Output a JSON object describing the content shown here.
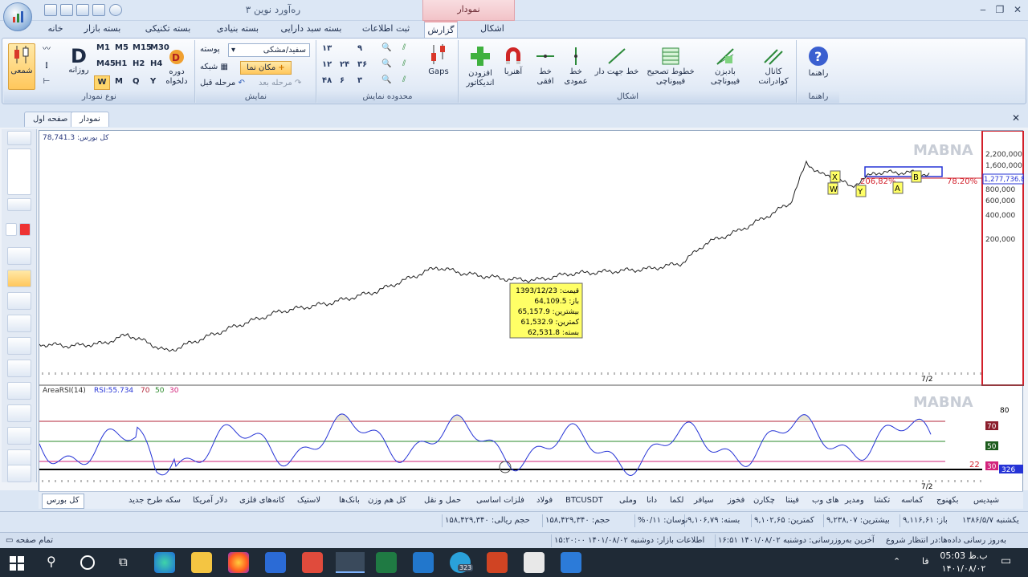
{
  "window": {
    "title": "ره‌آورد نوین ۳",
    "context_tab": "نمودار",
    "min": "‒",
    "restore": "❐",
    "close": "✕"
  },
  "tabs": [
    "خانه",
    "بسته بازار",
    "بسته تکنیکی",
    "بسته بنیادی",
    "بسته سبد دارایی",
    "ثبت اطلاعات",
    "گزارش",
    "اشکال"
  ],
  "ribbon": {
    "chart_type": {
      "label": "نوع نمودار",
      "candle": "شمعی",
      "daily": "روزانه",
      "period": "دوره دلخواه",
      "frames": [
        "M1",
        "M5",
        "M15",
        "M30",
        "M45",
        "H1",
        "H2",
        "H4"
      ],
      "wmqy": [
        "W",
        "M",
        "Q",
        "Y"
      ],
      "d": "D"
    },
    "display": {
      "label": "نمایش",
      "theme": "سفید/مشکی",
      "skin": "پوسته",
      "pointer": "مکان نما",
      "grid": "شبکه",
      "prev": "مرحله قبل",
      "next": "مرحله بعد"
    },
    "range": {
      "label": "محدوده نمایش",
      "nums": [
        "۱۳",
        "۱۲",
        "۴۸",
        "۹",
        "۲۴",
        "۶",
        "۳۶",
        "۳"
      ]
    },
    "report": {
      "gaps": "Gaps",
      "add_indicator": "افزودن اندیکاتور",
      "magnet": "آهنربا"
    },
    "shapes": {
      "label": "اشکال",
      "horizontal": "خط افقی",
      "vertical": "خط عمودی",
      "trend": "خط جهت دار",
      "fib_lines": "خطوط تصحیح فیبوناچی",
      "fib_fan": "بادبزن فیبوناچی",
      "quad": "کانال کوادرانت"
    },
    "help": {
      "label": "راهنما",
      "btn": "راهنما"
    }
  },
  "subtabs": {
    "chart": "نمودار",
    "page1": "صفحه اول"
  },
  "chart": {
    "watermark": "MABNA",
    "index_label": "کل بورس: 78,741.3",
    "yaxis": [
      "2,200,000",
      "1,600,000",
      "800,000",
      "600,000",
      "400,000",
      "200,000"
    ],
    "last_price": "1,277,736.8",
    "pct": "78.20%",
    "fib_text": "206,82%",
    "waves": [
      "X",
      "W",
      "Y",
      "A",
      "B"
    ],
    "tooltip": {
      "date": "1393/12/23 :قیمت",
      "open": "باز: 64,109.5",
      "high": "بیشترین: 65,157.9",
      "low": "کمترین: 61,532.9",
      "close": "بسته: 62,531.8"
    },
    "date_tick": "7/2",
    "rsi_header": "AreaRSI(14)",
    "rsi_value": "RSI:55.734",
    "lvl70": "70",
    "lvl50": "50",
    "lvl30": "30",
    "rsi_axis_80": "80",
    "rsi_tag70": "70",
    "rsi_tag50": "50",
    "rsi_tag30": "30",
    "rsi_left": "22",
    "rsi_right": "326"
  },
  "bottom_tabs": [
    "شپدیس",
    "بکهنوج",
    "کماسه",
    "تکشا",
    "ومدیر",
    "های وب",
    "فینتا",
    "چکارن",
    "فخوز",
    "سیافر",
    "لکما",
    "دانا",
    "وملی",
    "BTCUSDT",
    "فولاد",
    "فلزات اساسی",
    "حمل و نقل",
    "کل هم وزن",
    "بانک‌ها",
    "لاستیک",
    "کانه‌های فلزی",
    "دلار آمریکا",
    "سکه طرح جدید",
    "کل بورس"
  ],
  "status1": [
    "یکشنبه ۱۳۸۶/۵/۷",
    "باز: ۹,۱۱۶,۶۱",
    "بیشترین: ۹,۲۳۸,۰۷",
    "کمترین: ۹,۱۰۲,۶۵",
    "بسته: ۹,۱۰۶,۷۹",
    "نوسان: ۰/۱۱%",
    "حجم: ۱۵۸,۴۲۹,۳۴۰",
    "حجم ریالی: ۱۵۸,۴۲۹,۳۴۰"
  ],
  "status2": [
    "به‌روز رسانی داده‌ها:در انتظار شروع",
    "آخرین به‌روزرسانی: دوشنبه ۱۴۰۱/۰۸/۰۲ ۱۶:۵۱",
    "اطلاعات بازار: دوشنبه ۱۴۰۱/۰۸/۰۲ ۱۵:۲۰:۰۰",
    "تمام صفحه"
  ],
  "taskbar": {
    "time": "05:03 ب.ظ",
    "date": "۱۴۰۱/۰۸/۰۲",
    "lang": "فا",
    "badge": "323"
  },
  "colors": {
    "accent": "#2b579a",
    "rsi": "#2533d6",
    "line70": "#b3263a",
    "line50": "#2a8a2a",
    "line30": "#d2237b",
    "tooltip": "#ffff66"
  }
}
